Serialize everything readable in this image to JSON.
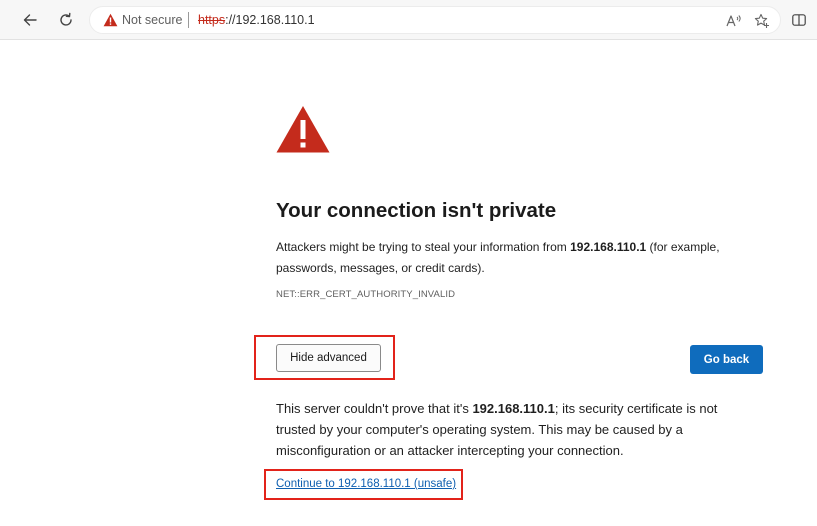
{
  "browser": {
    "security_label": "Not secure",
    "url_scheme": "https",
    "url_rest": "://192.168.110.1",
    "icons": {
      "back": "back-arrow-icon",
      "refresh": "refresh-icon",
      "warning": "warning-triangle-icon",
      "read_aloud": "read-aloud-icon",
      "favorite": "add-favorite-icon",
      "split": "split-screen-icon"
    }
  },
  "page": {
    "heading": "Your connection isn't private",
    "intro_before": "Attackers might be trying to steal your information from ",
    "host": "192.168.110.1",
    "intro_after": " (for example, passwords, messages, or credit cards).",
    "error_code": "NET::ERR_CERT_AUTHORITY_INVALID",
    "hide_advanced_label": "Hide advanced",
    "go_back_label": "Go back",
    "advanced_before": "This server couldn't prove that it's ",
    "advanced_after": "; its security certificate is not trusted by your computer's operating system. This may be caused by a misconfiguration or an attacker intercepting your connection.",
    "continue_link": "Continue to 192.168.110.1 (unsafe)"
  },
  "colors": {
    "warning_red": "#c42b1c",
    "primary_blue": "#0f6cbd",
    "link_blue": "#0f5fb0",
    "highlight_red": "#e2231a"
  }
}
